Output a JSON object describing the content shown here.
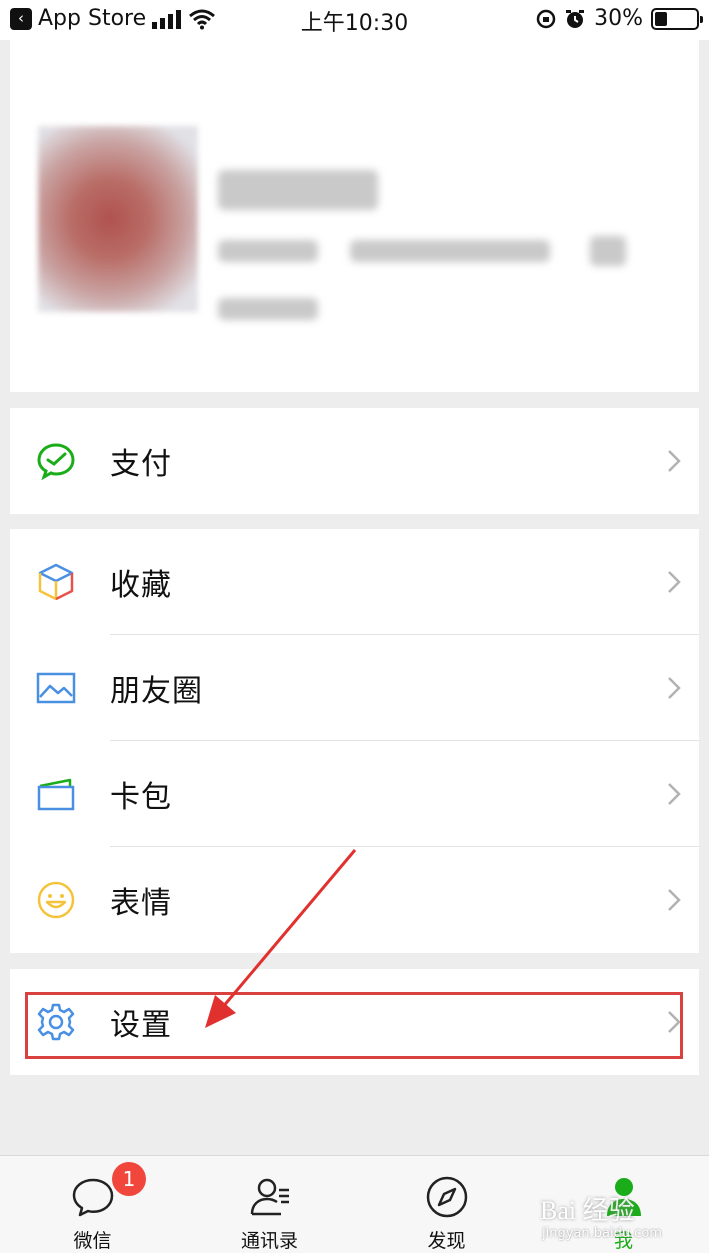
{
  "status_bar": {
    "back_app": "App Store",
    "time": "上午10:30",
    "battery": "30%",
    "battery_level": 0.3
  },
  "menu": {
    "pay": "支付",
    "favorites": "收藏",
    "moments": "朋友圈",
    "cards": "卡包",
    "stickers": "表情",
    "settings": "设置"
  },
  "tabs": {
    "chats": "微信",
    "chats_badge": "1",
    "contacts": "通讯录",
    "discover": "发现",
    "me": "我"
  },
  "watermark": {
    "text": "Bai 经验",
    "sub": "jingyan.baidu.com"
  },
  "colors": {
    "accent_green": "#1aad19",
    "highlight_red": "#d94141",
    "badge_red": "#f0463c",
    "icon_blue": "#4a90e2",
    "icon_yellow": "#f5c33b"
  },
  "icons": [
    "wechat-pay-icon",
    "favorites-cube-icon",
    "moments-photo-icon",
    "card-wallet-icon",
    "sticker-smile-icon",
    "settings-gear-icon",
    "chat-bubble-icon",
    "contacts-person-icon",
    "compass-icon",
    "me-person-icon"
  ]
}
